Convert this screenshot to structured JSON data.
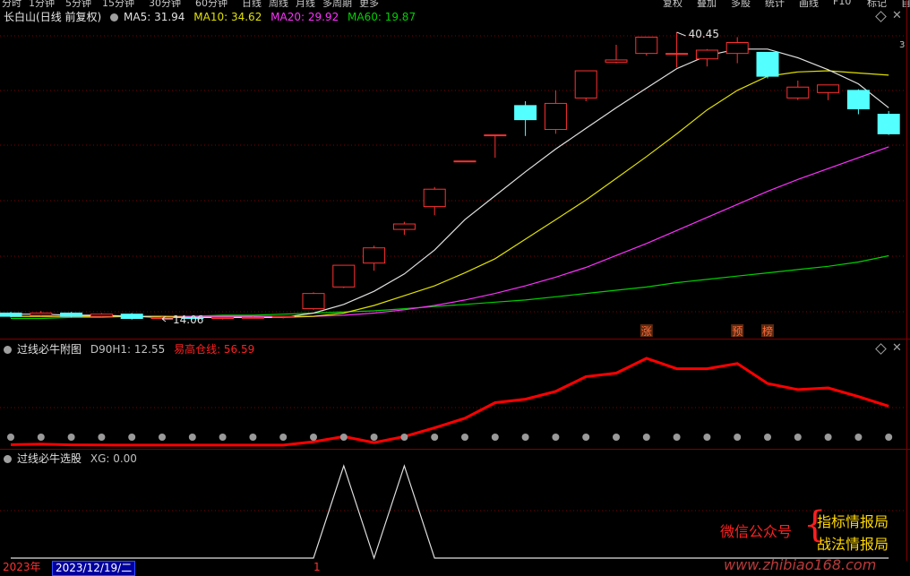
{
  "menu": {
    "left_items": [
      "分时",
      "1分钟",
      "5分钟",
      "15分钟",
      "30分钟",
      "60分钟",
      "日线",
      "周线",
      "月线",
      "多周期",
      "更多"
    ],
    "right_items": [
      "复权",
      "叠加",
      "多股",
      "统计",
      "画线",
      "F10",
      "标记",
      "自动"
    ]
  },
  "main_panel": {
    "stock_name": "长白山",
    "period": "(日线 前复权)",
    "ma5_label": "MA5: 31.94",
    "ma10_label": "MA10: 34.62",
    "ma20_label": "MA20: 29.92",
    "ma60_label": "MA60: 19.87",
    "high_label": "40.45",
    "low_label": "14.06",
    "right_edge_tick": "3",
    "signal_zhang": "涨",
    "signal_yu": "预",
    "signal_bang": "榜"
  },
  "indicator1": {
    "name": "过线必牛附图",
    "field1": "D90H1: 12.55",
    "field2": "易高仓线: 56.59"
  },
  "indicator2": {
    "name": "过线必牛选股",
    "field1": "XG: 0.00"
  },
  "footer": {
    "year": "2023年",
    "date": "2023/12/19/二",
    "tick": "1"
  },
  "watermark": {
    "wechat": "微信公众号",
    "brand1": "指标情报局",
    "brand2": "战法情报局",
    "url": "www.zhibiao168.com"
  },
  "colors": {
    "up": "#ff3030",
    "down": "#54ffff",
    "ma5": "#e0e0e0",
    "ma10": "#e0e000",
    "ma20": "#ff30ff",
    "ma60": "#00d000",
    "indicator_line": "#ff0000",
    "grid": "#800000"
  },
  "chart_data": [
    {
      "type": "candlestick",
      "title": "长白山 (日线 前复权)",
      "series": [
        {
          "name": "MA5",
          "value": 31.94
        },
        {
          "name": "MA10",
          "value": 34.62
        },
        {
          "name": "MA20",
          "value": 29.92
        },
        {
          "name": "MA60",
          "value": 19.87
        }
      ],
      "annotations": [
        {
          "label": "40.45",
          "kind": "high"
        },
        {
          "label": "14.06",
          "kind": "low"
        }
      ],
      "candles": [
        {
          "o": 14.6,
          "c": 14.3,
          "h": 14.7,
          "l": 14.2
        },
        {
          "o": 14.4,
          "c": 14.6,
          "h": 14.8,
          "l": 14.3
        },
        {
          "o": 14.6,
          "c": 14.3,
          "h": 14.7,
          "l": 14.2
        },
        {
          "o": 14.3,
          "c": 14.5,
          "h": 14.6,
          "l": 14.2
        },
        {
          "o": 14.5,
          "c": 14.1,
          "h": 14.6,
          "l": 14.0
        },
        {
          "o": 14.1,
          "c": 14.2,
          "h": 14.3,
          "l": 14.06
        },
        {
          "o": 14.2,
          "c": 14.1,
          "h": 14.3,
          "l": 14.0
        },
        {
          "o": 14.1,
          "c": 14.2,
          "h": 14.2,
          "l": 14.0
        },
        {
          "o": 14.2,
          "c": 14.2,
          "h": 14.3,
          "l": 14.1
        },
        {
          "o": 14.2,
          "c": 14.3,
          "h": 14.3,
          "l": 14.1
        },
        {
          "o": 15.0,
          "c": 16.4,
          "h": 16.5,
          "l": 14.9
        },
        {
          "o": 17.0,
          "c": 19.0,
          "h": 19.0,
          "l": 16.9
        },
        {
          "o": 19.2,
          "c": 20.6,
          "h": 20.8,
          "l": 18.5
        },
        {
          "o": 22.3,
          "c": 22.8,
          "h": 23.0,
          "l": 21.8
        },
        {
          "o": 24.4,
          "c": 26.0,
          "h": 26.2,
          "l": 23.6
        },
        {
          "o": 28.6,
          "c": 28.6,
          "h": 28.6,
          "l": 28.6
        },
        {
          "o": 31.0,
          "c": 31.0,
          "h": 31.0,
          "l": 28.9
        },
        {
          "o": 33.7,
          "c": 32.4,
          "h": 34.1,
          "l": 30.9
        },
        {
          "o": 31.5,
          "c": 33.9,
          "h": 35.1,
          "l": 31.1
        },
        {
          "o": 34.4,
          "c": 36.9,
          "h": 36.9,
          "l": 34.1
        },
        {
          "o": 37.7,
          "c": 37.9,
          "h": 39.3,
          "l": 37.6
        },
        {
          "o": 38.5,
          "c": 40.0,
          "h": 40.0,
          "l": 38.3
        },
        {
          "o": 38.5,
          "c": 38.5,
          "h": 40.45,
          "l": 37.2
        },
        {
          "o": 38.0,
          "c": 38.8,
          "h": 38.9,
          "l": 37.3
        },
        {
          "o": 38.5,
          "c": 39.5,
          "h": 40.0,
          "l": 37.6
        },
        {
          "o": 38.6,
          "c": 36.4,
          "h": 38.6,
          "l": 36.2
        },
        {
          "o": 34.4,
          "c": 35.4,
          "h": 36.0,
          "l": 34.2
        },
        {
          "o": 34.9,
          "c": 35.6,
          "h": 35.6,
          "l": 34.2
        },
        {
          "o": 35.1,
          "c": 33.4,
          "h": 35.2,
          "l": 32.9
        },
        {
          "o": 32.9,
          "c": 31.1,
          "h": 33.2,
          "l": 31.0
        }
      ],
      "ma5": [
        14.5,
        14.5,
        14.4,
        14.4,
        14.3,
        14.2,
        14.2,
        14.2,
        14.2,
        14.2,
        14.6,
        15.4,
        16.6,
        18.2,
        20.4,
        23.2,
        25.4,
        27.6,
        29.7,
        31.6,
        33.5,
        35.3,
        37.1,
        38.3,
        38.9,
        38.9,
        38.1,
        37.0,
        35.7,
        33.5
      ],
      "ma10": [
        14.3,
        14.3,
        14.3,
        14.3,
        14.3,
        14.3,
        14.2,
        14.2,
        14.2,
        14.2,
        14.3,
        14.6,
        15.3,
        16.2,
        17.1,
        18.3,
        19.6,
        21.4,
        23.2,
        25.0,
        27.0,
        29.0,
        31.1,
        33.3,
        35.1,
        36.4,
        36.8,
        36.9,
        36.7,
        36.5
      ],
      "ma20": [
        14.3,
        14.3,
        14.3,
        14.3,
        14.3,
        14.3,
        14.3,
        14.3,
        14.3,
        14.3,
        14.3,
        14.4,
        14.6,
        14.9,
        15.3,
        15.8,
        16.4,
        17.1,
        17.9,
        18.8,
        19.9,
        21.0,
        22.2,
        23.4,
        24.6,
        25.8,
        26.9,
        27.9,
        28.9,
        29.9
      ],
      "ma60": [
        14.1,
        14.1,
        14.2,
        14.2,
        14.3,
        14.3,
        14.3,
        14.4,
        14.4,
        14.5,
        14.6,
        14.7,
        14.8,
        15.0,
        15.2,
        15.4,
        15.6,
        15.8,
        16.1,
        16.4,
        16.7,
        17.0,
        17.4,
        17.7,
        18.0,
        18.3,
        18.6,
        18.9,
        19.3,
        19.87
      ]
    },
    {
      "type": "line",
      "title": "过线必牛附图",
      "series": [
        {
          "name": "易高仓线",
          "values": [
            0.6,
            1.3,
            0.4,
            0.2,
            0.1,
            0.1,
            0.1,
            0.1,
            0.1,
            0.1,
            4,
            10,
            3,
            10,
            20,
            31,
            49,
            53,
            62,
            79,
            83,
            100,
            88,
            88,
            94,
            71,
            64,
            66,
            56,
            45
          ]
        }
      ]
    },
    {
      "type": "line",
      "title": "过线必牛选股",
      "series": [
        {
          "name": "XG",
          "values": [
            0,
            0,
            0,
            0,
            0,
            0,
            0,
            0,
            0,
            0,
            0,
            1,
            0,
            1,
            0,
            0,
            0,
            0,
            0,
            0,
            0,
            0,
            0,
            0,
            0,
            0,
            0,
            0,
            0,
            0
          ]
        }
      ]
    }
  ]
}
